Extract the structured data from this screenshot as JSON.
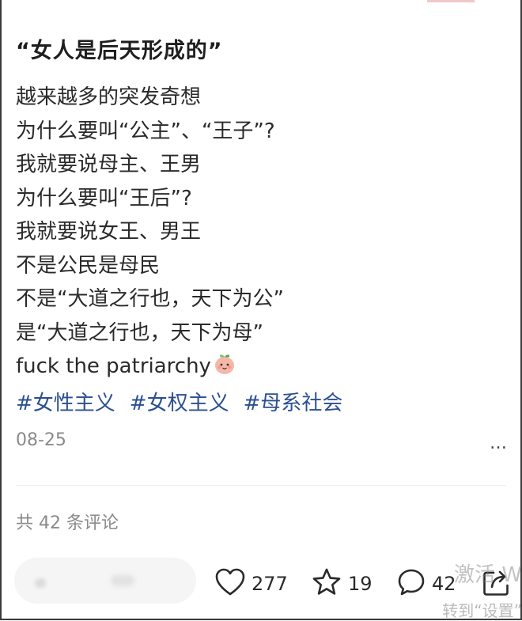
{
  "post": {
    "title": "“女人是后天形成的”",
    "lines": [
      "越来越多的突发奇想",
      "为什么要叫“公主”、“王子”?",
      "我就要说母主、王男",
      "为什么要叫“王后”?",
      "我就要说女王、男王",
      "不是公民是母民",
      "不是“大道之行也，天下为公”",
      "是“大道之行也，天下为母”",
      "fuck the patriarchy"
    ],
    "emoji_icon": "peach-face-icon",
    "tags": [
      "#女性主义",
      "#女权主义",
      "#母系社会"
    ],
    "date": "08-25",
    "more_label": "…"
  },
  "comments": {
    "total_label": "共 42 条评论"
  },
  "actions": {
    "like_count": "277",
    "star_count": "19",
    "comment_count": "42",
    "like_icon": "heart-icon",
    "star_icon": "star-icon",
    "comment_icon": "comment-bubble-icon",
    "share_icon": "share-icon"
  },
  "watermark": {
    "line1": "激活 W",
    "line2": "转到“设置”"
  },
  "colors": {
    "tag": "#2b4f91",
    "muted": "#8a8a8a",
    "text": "#2a2a2a"
  }
}
